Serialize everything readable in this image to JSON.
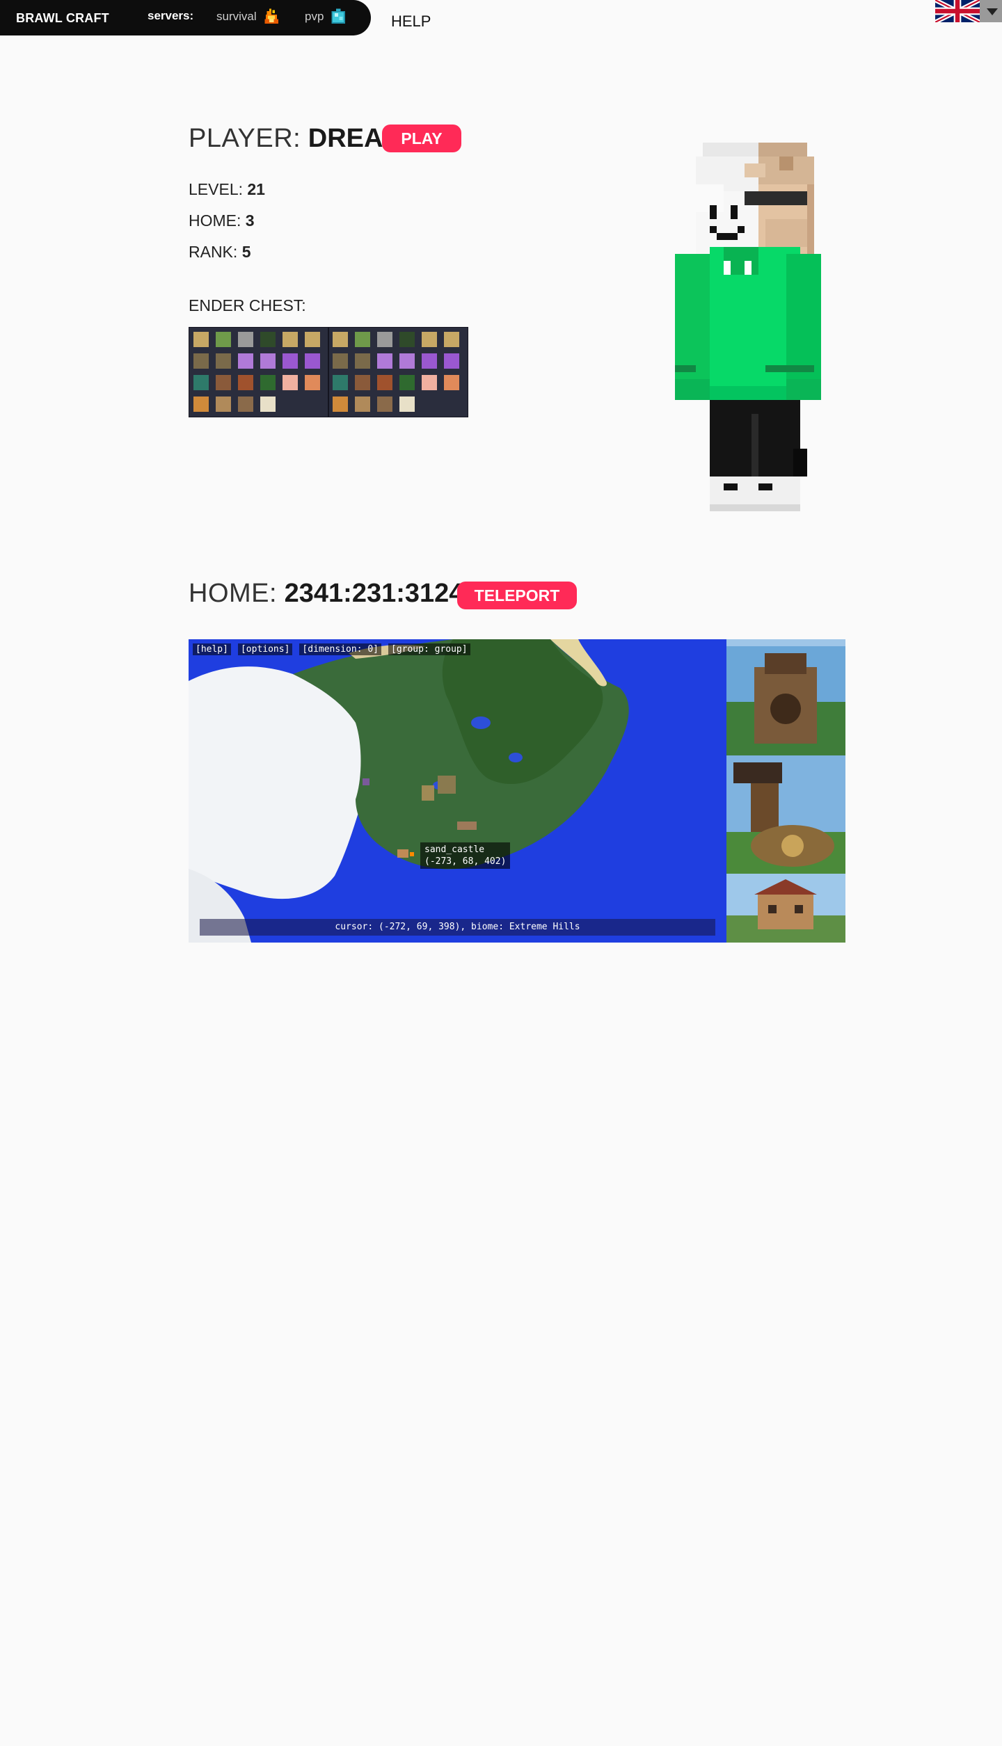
{
  "nav": {
    "brand": "BRAWL CRAFT",
    "servers_label": "servers:",
    "servers": [
      {
        "label": "survival",
        "icon": "fire-icon"
      },
      {
        "label": "pvp",
        "icon": "diamond-icon"
      }
    ],
    "help": "HELP",
    "language": {
      "icon": "uk-flag-icon",
      "dropdown": "caret-down-icon"
    }
  },
  "player": {
    "label": "PLAYER:",
    "name": "DREAM",
    "play_button": "PLAY",
    "level_label": "LEVEL:",
    "level": "21",
    "home_label": "HOME:",
    "home": "3",
    "rank_label": "RANK:",
    "rank": "5",
    "ender_chest_label": "ENDER CHEST:"
  },
  "home": {
    "label": "HOME:",
    "coords": "2341:231:3124",
    "teleport_button": "TELEPORT"
  },
  "map": {
    "toolbar": [
      "[help]",
      "[options]",
      "[dimension: 0]",
      "[group: group]"
    ],
    "marker_name": "sand_castle",
    "marker_coords": "(-273, 68, 402)",
    "status": "cursor: (-272, 69, 398), biome: Extreme Hills"
  },
  "colors": {
    "accent": "#ff2a57",
    "topbar": "#0d0d0d",
    "background": "#fafafa"
  }
}
